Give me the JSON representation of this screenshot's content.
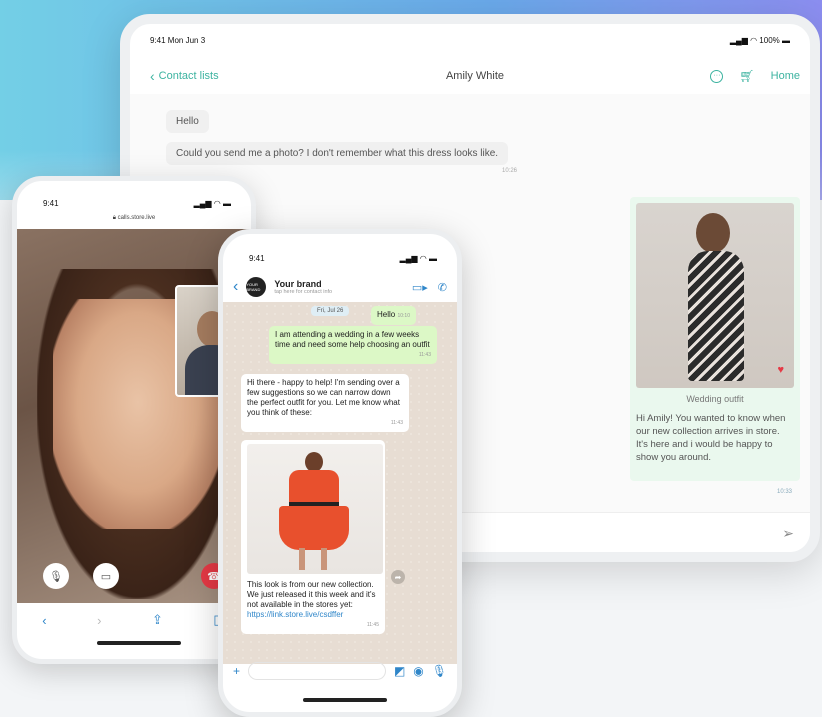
{
  "tablet": {
    "status_time": "9:41 Mon Jun 3",
    "status_battery": "100%",
    "back_label": "Contact lists",
    "title": "Amily White",
    "home_label": "Home",
    "messages": {
      "m1": "Hello",
      "m2": "Could you send me a photo? I don't remember what this dress looks like.",
      "m2_time": "10:26"
    },
    "card": {
      "caption": "Wedding outfit",
      "text": "Hi Amily! You wanted to know when our new collection arrives in store. It's here and i would be happy to show you around.",
      "time": "10:33"
    }
  },
  "phone_left": {
    "status_time": "9:41",
    "url": "calls.store.live"
  },
  "phone_mid": {
    "status_time": "9:41",
    "avatar_text": "YOUR BRAND",
    "brand_name": "Your brand",
    "brand_sub": "tap here for contact info",
    "date_chip": "Fri, Jul 26",
    "msg_hello": "Hello",
    "msg_hello_time": "10:10",
    "msg_wedding": "I am attending a wedding in a few weeks time and need some help choosing an outfit",
    "msg_wedding_time": "11:43",
    "msg_reply": "Hi there - happy to help! I'm sending over a few suggestions so we can narrow down the perfect outfit for you. Let me know what you think of these:",
    "msg_reply_time": "11:43",
    "msg_photo_text": "This look is from our new collection. We just released it this week and it's not available in the stores yet:",
    "msg_link": "https://link.store.live/csdffer",
    "msg_photo_time": "11:45"
  }
}
